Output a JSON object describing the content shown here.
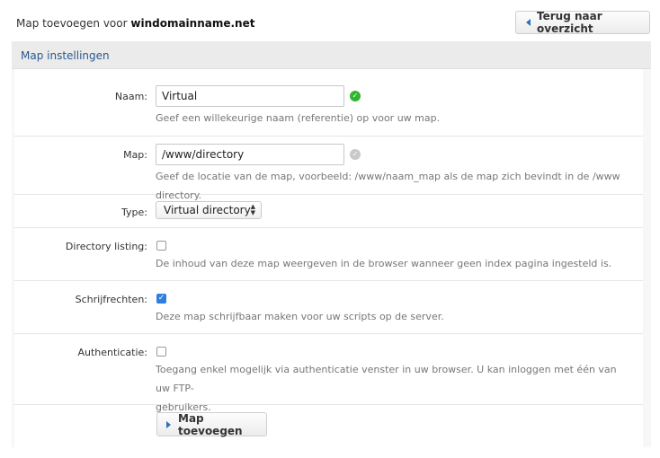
{
  "header": {
    "title_prefix": "Map toevoegen voor",
    "domain": "windomainname.net",
    "back_label": "Terug naar overzicht"
  },
  "panel": {
    "title": "Map instellingen"
  },
  "form": {
    "name": {
      "label": "Naam:",
      "value": "Virtual",
      "help": "Geef een willekeurige naam (referentie) op voor uw map.",
      "status_icon": "check-circle-green"
    },
    "map": {
      "label": "Map:",
      "value": "/www/directory",
      "help": "Geef de locatie van de map, voorbeeld: /www/naam_map als de map zich bevindt in de /www directory.",
      "status_icon": "check-circle-grey"
    },
    "type": {
      "label": "Type:",
      "selected": "Virtual directory"
    },
    "directory_listing": {
      "label": "Directory listing:",
      "checked": false,
      "help": "De inhoud van deze map weergeven in de browser wanneer geen index pagina ingesteld is."
    },
    "write": {
      "label": "Schrijfrechten:",
      "checked": true,
      "help": "Deze map schrijfbaar maken voor uw scripts op de server."
    },
    "auth": {
      "label": "Authenticatie:",
      "checked": false,
      "help_line1": "Toegang enkel mogelijk via authenticatie venster in uw browser. U kan inloggen met één van uw FTP-",
      "help_line2": "gebruikers."
    },
    "submit_label": "Map toevoegen"
  },
  "colors": {
    "accent": "#2a73b8",
    "ok_green": "#2fb52f",
    "checkbox_blue": "#2f7fe0"
  }
}
